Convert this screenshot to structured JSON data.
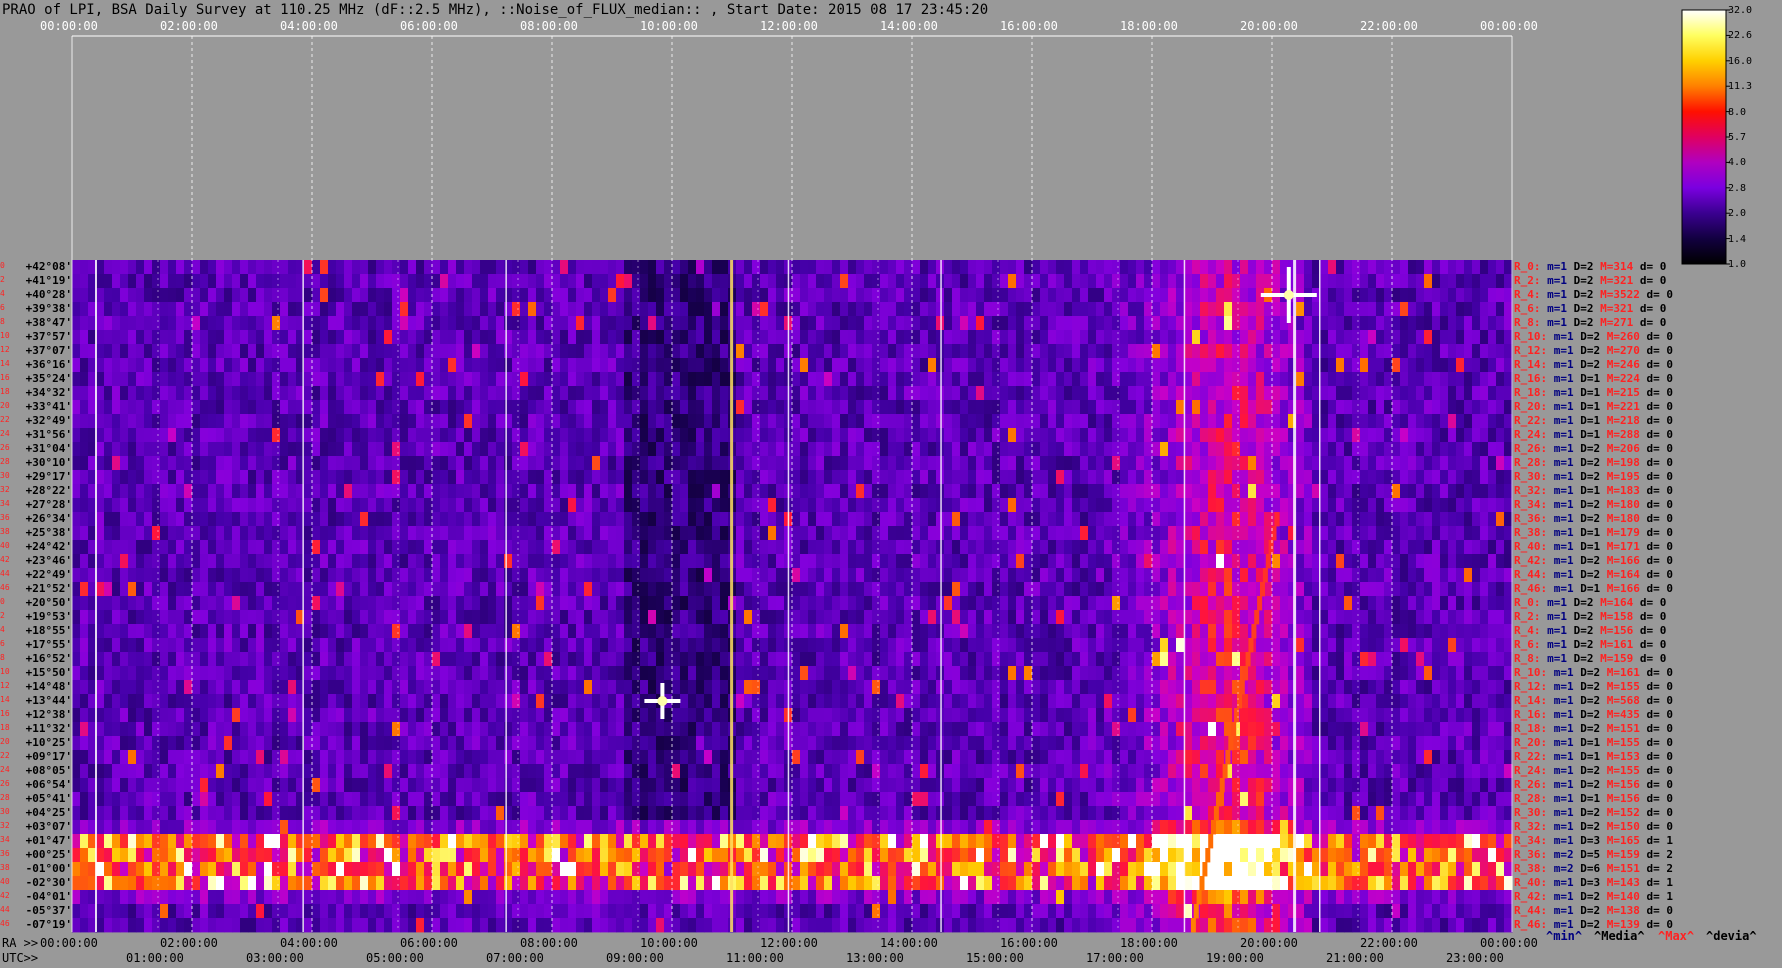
{
  "title": "PRAO of LPI, BSA Daily Survey at 110.25 MHz (dF::2.5 MHz), ::Noise_of_FLUX_median:: , Start Date: 2015 08 17 23:45:20",
  "colorbar": {
    "labels": [
      "32.0",
      "22.6",
      "16.0",
      "11.3",
      "8.0",
      "5.7",
      "4.0",
      "2.8",
      "2.0",
      "1.4",
      "1.0"
    ],
    "colors": [
      "#ffffff",
      "#ffff60",
      "#ffd000",
      "#ff8000",
      "#ff1000",
      "#e00060",
      "#b000c0",
      "#7a00e0",
      "#3a0090",
      "#120040",
      "#000000"
    ]
  },
  "top_axis_labels": [
    "00:00:00",
    "02:00:00",
    "04:00:00",
    "06:00:00",
    "08:00:00",
    "10:00:00",
    "12:00:00",
    "14:00:00",
    "16:00:00",
    "18:00:00",
    "20:00:00",
    "22:00:00",
    "00:00:00"
  ],
  "ra_prefix": "RA >>",
  "ra_labels": [
    "00:00:00",
    "02:00:00",
    "04:00:00",
    "06:00:00",
    "08:00:00",
    "10:00:00",
    "12:00:00",
    "14:00:00",
    "16:00:00",
    "18:00:00",
    "20:00:00",
    "22:00:00",
    "00:00:00"
  ],
  "utc_prefix": "UTC>>",
  "utc_labels": [
    "01:00:00",
    "03:00:00",
    "05:00:00",
    "07:00:00",
    "09:00:00",
    "11:00:00",
    "13:00:00",
    "15:00:00",
    "17:00:00",
    "19:00:00",
    "21:00:00",
    "23:00:00"
  ],
  "legend": {
    "min": "^min^",
    "media": "^Media^",
    "max": "^Max^",
    "devia": "^devia^"
  },
  "rows": [
    {
      "i": "0",
      "dec": "+42°08'",
      "r": "R_0:",
      "m": "m=1",
      "D": "D=2",
      "M": "M=314",
      "d": "d= 0"
    },
    {
      "i": "2",
      "dec": "+41°19'",
      "r": "R_2:",
      "m": "m=1",
      "D": "D=2",
      "M": "M=321",
      "d": "d= 0"
    },
    {
      "i": "4",
      "dec": "+40°28'",
      "r": "R_4:",
      "m": "m=1",
      "D": "D=2",
      "M": "M=3522",
      "d": "d= 0"
    },
    {
      "i": "6",
      "dec": "+39°38'",
      "r": "R_6:",
      "m": "m=1",
      "D": "D=2",
      "M": "M=321",
      "d": "d= 0"
    },
    {
      "i": "8",
      "dec": "+38°47'",
      "r": "R_8:",
      "m": "m=1",
      "D": "D=2",
      "M": "M=271",
      "d": "d= 0"
    },
    {
      "i": "10",
      "dec": "+37°57'",
      "r": "R_10:",
      "m": "m=1",
      "D": "D=2",
      "M": "M=260",
      "d": "d= 0"
    },
    {
      "i": "12",
      "dec": "+37°07'",
      "r": "R_12:",
      "m": "m=1",
      "D": "D=2",
      "M": "M=270",
      "d": "d= 0"
    },
    {
      "i": "14",
      "dec": "+36°16'",
      "r": "R_14:",
      "m": "m=1",
      "D": "D=2",
      "M": "M=246",
      "d": "d= 0"
    },
    {
      "i": "16",
      "dec": "+35°24'",
      "r": "R_16:",
      "m": "m=1",
      "D": "D=1",
      "M": "M=224",
      "d": "d= 0"
    },
    {
      "i": "18",
      "dec": "+34°32'",
      "r": "R_18:",
      "m": "m=1",
      "D": "D=1",
      "M": "M=215",
      "d": "d= 0"
    },
    {
      "i": "20",
      "dec": "+33°41'",
      "r": "R_20:",
      "m": "m=1",
      "D": "D=1",
      "M": "M=221",
      "d": "d= 0"
    },
    {
      "i": "22",
      "dec": "+32°49'",
      "r": "R_22:",
      "m": "m=1",
      "D": "D=1",
      "M": "M=218",
      "d": "d= 0"
    },
    {
      "i": "24",
      "dec": "+31°56'",
      "r": "R_24:",
      "m": "m=1",
      "D": "D=1",
      "M": "M=288",
      "d": "d= 0"
    },
    {
      "i": "26",
      "dec": "+31°04'",
      "r": "R_26:",
      "m": "m=1",
      "D": "D=2",
      "M": "M=206",
      "d": "d= 0"
    },
    {
      "i": "28",
      "dec": "+30°10'",
      "r": "R_28:",
      "m": "m=1",
      "D": "D=2",
      "M": "M=198",
      "d": "d= 0"
    },
    {
      "i": "30",
      "dec": "+29°17'",
      "r": "R_30:",
      "m": "m=1",
      "D": "D=2",
      "M": "M=195",
      "d": "d= 0"
    },
    {
      "i": "32",
      "dec": "+28°22'",
      "r": "R_32:",
      "m": "m=1",
      "D": "D=1",
      "M": "M=183",
      "d": "d= 0"
    },
    {
      "i": "34",
      "dec": "+27°28'",
      "r": "R_34:",
      "m": "m=1",
      "D": "D=2",
      "M": "M=180",
      "d": "d= 0"
    },
    {
      "i": "36",
      "dec": "+26°34'",
      "r": "R_36:",
      "m": "m=1",
      "D": "D=2",
      "M": "M=180",
      "d": "d= 0"
    },
    {
      "i": "38",
      "dec": "+25°38'",
      "r": "R_38:",
      "m": "m=1",
      "D": "D=1",
      "M": "M=179",
      "d": "d= 0"
    },
    {
      "i": "40",
      "dec": "+24°42'",
      "r": "R_40:",
      "m": "m=1",
      "D": "D=1",
      "M": "M=171",
      "d": "d= 0"
    },
    {
      "i": "42",
      "dec": "+23°46'",
      "r": "R_42:",
      "m": "m=1",
      "D": "D=2",
      "M": "M=166",
      "d": "d= 0"
    },
    {
      "i": "44",
      "dec": "+22°49'",
      "r": "R_44:",
      "m": "m=1",
      "D": "D=2",
      "M": "M=164",
      "d": "d= 0"
    },
    {
      "i": "46",
      "dec": "+21°52'",
      "r": "R_46:",
      "m": "m=1",
      "D": "D=1",
      "M": "M=166",
      "d": "d= 0"
    },
    {
      "i": "0",
      "dec": "+20°50'",
      "r": "R_0:",
      "m": "m=1",
      "D": "D=2",
      "M": "M=164",
      "d": "d= 0"
    },
    {
      "i": "2",
      "dec": "+19°53'",
      "r": "R_2:",
      "m": "m=1",
      "D": "D=2",
      "M": "M=158",
      "d": "d= 0"
    },
    {
      "i": "4",
      "dec": "+18°55'",
      "r": "R_4:",
      "m": "m=1",
      "D": "D=2",
      "M": "M=156",
      "d": "d= 0"
    },
    {
      "i": "6",
      "dec": "+17°55'",
      "r": "R_6:",
      "m": "m=1",
      "D": "D=2",
      "M": "M=161",
      "d": "d= 0"
    },
    {
      "i": "8",
      "dec": "+16°52'",
      "r": "R_8:",
      "m": "m=1",
      "D": "D=2",
      "M": "M=159",
      "d": "d= 0"
    },
    {
      "i": "10",
      "dec": "+15°50'",
      "r": "R_10:",
      "m": "m=1",
      "D": "D=2",
      "M": "M=161",
      "d": "d= 0"
    },
    {
      "i": "12",
      "dec": "+14°48'",
      "r": "R_12:",
      "m": "m=1",
      "D": "D=2",
      "M": "M=155",
      "d": "d= 0"
    },
    {
      "i": "14",
      "dec": "+13°44'",
      "r": "R_14:",
      "m": "m=1",
      "D": "D=2",
      "M": "M=568",
      "d": "d= 0"
    },
    {
      "i": "16",
      "dec": "+12°38'",
      "r": "R_16:",
      "m": "m=1",
      "D": "D=2",
      "M": "M=435",
      "d": "d= 0"
    },
    {
      "i": "18",
      "dec": "+11°32'",
      "r": "R_18:",
      "m": "m=1",
      "D": "D=2",
      "M": "M=151",
      "d": "d= 0"
    },
    {
      "i": "20",
      "dec": "+10°25'",
      "r": "R_20:",
      "m": "m=1",
      "D": "D=1",
      "M": "M=155",
      "d": "d= 0"
    },
    {
      "i": "22",
      "dec": "+09°17'",
      "r": "R_22:",
      "m": "m=1",
      "D": "D=1",
      "M": "M=153",
      "d": "d= 0"
    },
    {
      "i": "24",
      "dec": "+08°05'",
      "r": "R_24:",
      "m": "m=1",
      "D": "D=2",
      "M": "M=155",
      "d": "d= 0"
    },
    {
      "i": "26",
      "dec": "+06°54'",
      "r": "R_26:",
      "m": "m=1",
      "D": "D=2",
      "M": "M=156",
      "d": "d= 0"
    },
    {
      "i": "28",
      "dec": "+05°41'",
      "r": "R_28:",
      "m": "m=1",
      "D": "D=1",
      "M": "M=156",
      "d": "d= 0"
    },
    {
      "i": "30",
      "dec": "+04°25'",
      "r": "R_30:",
      "m": "m=1",
      "D": "D=2",
      "M": "M=152",
      "d": "d= 0"
    },
    {
      "i": "32",
      "dec": "+03°07'",
      "r": "R_32:",
      "m": "m=1",
      "D": "D=2",
      "M": "M=150",
      "d": "d= 0"
    },
    {
      "i": "34",
      "dec": "+01°47'",
      "r": "R_34:",
      "m": "m=1",
      "D": "D=3",
      "M": "M=165",
      "d": "d= 1"
    },
    {
      "i": "36",
      "dec": "+00°25'",
      "r": "R_36:",
      "m": "m=2",
      "D": "D=5",
      "M": "M=159",
      "d": "d= 2"
    },
    {
      "i": "38",
      "dec": "-01°00'",
      "r": "R_38:",
      "m": "m=2",
      "D": "D=6",
      "M": "M=151",
      "d": "d= 2"
    },
    {
      "i": "40",
      "dec": "-02°30'",
      "r": "R_40:",
      "m": "m=1",
      "D": "D=3",
      "M": "M=143",
      "d": "d= 1"
    },
    {
      "i": "42",
      "dec": "-04°01'",
      "r": "R_42:",
      "m": "m=1",
      "D": "D=2",
      "M": "M=140",
      "d": "d= 1"
    },
    {
      "i": "44",
      "dec": "-05°37'",
      "r": "R_44:",
      "m": "m=1",
      "D": "D=2",
      "M": "M=138",
      "d": "d= 0"
    },
    {
      "i": "46",
      "dec": "-07°19'",
      "r": "R_46:",
      "m": "m=1",
      "D": "D=2",
      "M": "M=139",
      "d": "d= 0"
    }
  ],
  "chart_data": {
    "type": "heatmap",
    "title": "PRAO of LPI, BSA Daily Survey at 110.25 MHz (dF::2.5 MHz), ::Noise_of_FLUX_median:: , Start Date: 2015 08 17 23:45:20",
    "x_axis": "RA 00:00:00 to 24:00:00 (with UTC axis 01:00:00 to 23:00:00)",
    "y_axis": "Declination +42°08' to -07°19' (48 beams)",
    "colorbar_range": [
      1.0,
      32.0
    ],
    "colorbar_ticks": [
      32.0,
      22.6,
      16.0,
      11.3,
      8.0,
      5.7,
      4.0,
      2.8,
      2.0,
      1.4,
      1.0
    ],
    "features": [
      {
        "name": "bright band",
        "dec_range": [
          "+01°47'",
          "-02°30'"
        ],
        "level": 16.0
      },
      {
        "name": "diffuse emission",
        "ra_range": [
          "17:00:00",
          "20:30:00"
        ],
        "level": 4.0
      },
      {
        "name": "point source",
        "ra": "20:00:00",
        "dec": "+40°28'",
        "level": 32.0
      },
      {
        "name": "point source",
        "ra": "09:50:00",
        "dec": "+13°44'",
        "level": 32.0
      }
    ]
  }
}
